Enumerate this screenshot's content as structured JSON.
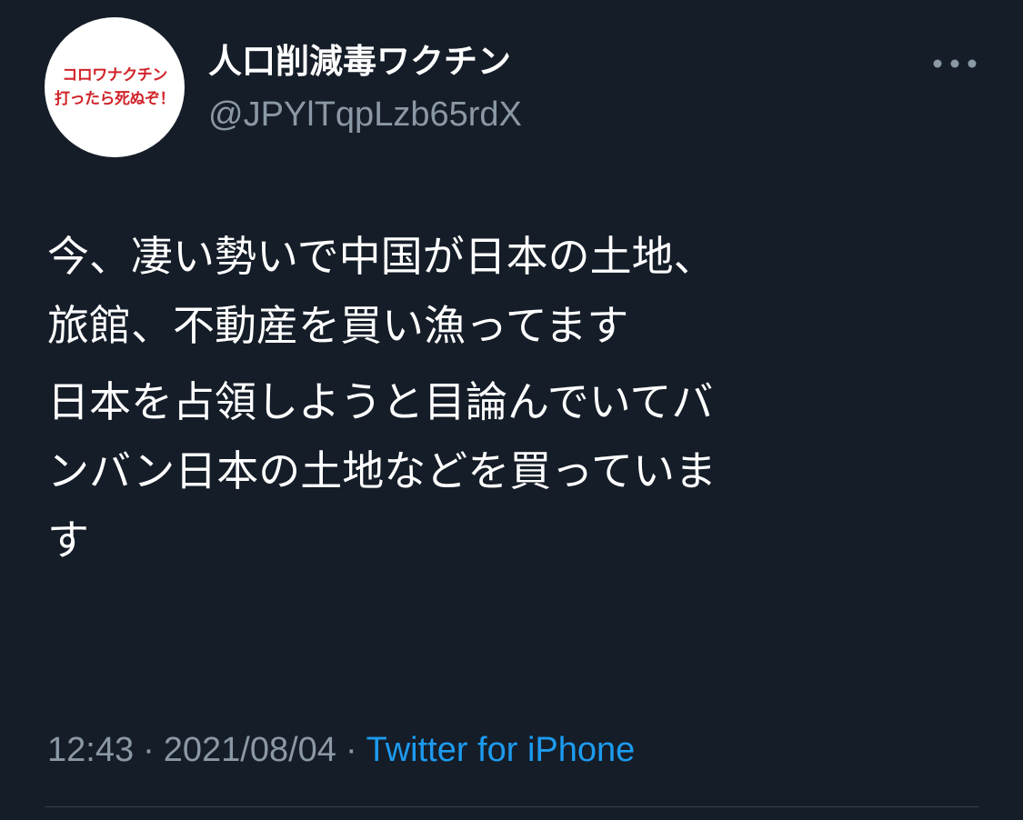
{
  "user": {
    "display_name": "人口削減毒ワクチン",
    "handle": "@JPYlTqpLzb65rdX",
    "avatar_text": {
      "line1": "コロワナクチン",
      "line2": "打ったら死ぬぞ！"
    }
  },
  "tweet": {
    "body": [
      [
        "今、凄い勢いで中国が日本の土地、",
        "旅館、不動産を買い漁ってます"
      ],
      [
        "日本を占領しようと目論んでいてバ",
        "ンバン日本の土地などを買っていま",
        "す"
      ]
    ],
    "time": "12:43",
    "date": "2021/08/04",
    "separator": "·",
    "source": "Twitter for iPhone"
  },
  "icons": {
    "more": "more-horizontal-icon"
  },
  "colors": {
    "background": "#151d28",
    "secondary_text": "#8b98a5",
    "link": "#1d9bf0",
    "avatar_text": "#d0242a"
  }
}
